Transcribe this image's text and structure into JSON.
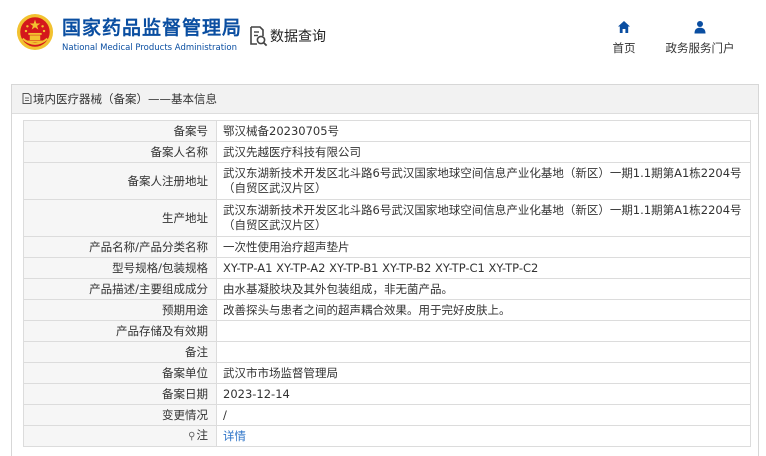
{
  "header": {
    "brand_cn": "国家药品监督管理局",
    "brand_en": "National Medical Products Administration",
    "query_label": "数据查询",
    "nav": {
      "home_label": "首页",
      "service_label": "政务服务门户"
    }
  },
  "panel": {
    "title": "境内医疗器械（备案）——基本信息"
  },
  "record": {
    "rows": [
      {
        "label": "备案号",
        "value": "鄂汉械备20230705号"
      },
      {
        "label": "备案人名称",
        "value": "武汉先越医疗科技有限公司"
      },
      {
        "label": "备案人注册地址",
        "value": "武汉东湖新技术开发区北斗路6号武汉国家地球空间信息产业化基地（新区）一期1.1期第A1栋2204号（自贸区武汉片区）"
      },
      {
        "label": "生产地址",
        "value": "武汉东湖新技术开发区北斗路6号武汉国家地球空间信息产业化基地（新区）一期1.1期第A1栋2204号（自贸区武汉片区）"
      },
      {
        "label": "产品名称/产品分类名称",
        "value": "一次性使用治疗超声垫片"
      },
      {
        "label": "型号规格/包装规格",
        "value": "XY-TP-A1 XY-TP-A2 XY-TP-B1 XY-TP-B2 XY-TP-C1 XY-TP-C2"
      },
      {
        "label": "产品描述/主要组成成分",
        "value": "由水基凝胶块及其外包装组成，非无菌产品。"
      },
      {
        "label": "预期用途",
        "value": "改善探头与患者之间的超声耦合效果。用于完好皮肤上。"
      },
      {
        "label": "产品存储及有效期",
        "value": ""
      },
      {
        "label": "备注",
        "value": ""
      },
      {
        "label": "备案单位",
        "value": "武汉市市场监督管理局"
      },
      {
        "label": "备案日期",
        "value": "2023-12-14"
      },
      {
        "label": "变更情况",
        "value": "/"
      }
    ],
    "note_label": "注",
    "note_link": "详情"
  },
  "colors": {
    "brand_blue": "#0a4ea1",
    "link_blue": "#2a72c7",
    "emblem_red": "#d4181c",
    "emblem_gold": "#f2c230"
  },
  "icons": {
    "emblem": "national-emblem-icon",
    "query": "document-search-icon",
    "home": "home-icon",
    "service": "user-icon",
    "title": "document-icon",
    "note": "pin-icon"
  }
}
